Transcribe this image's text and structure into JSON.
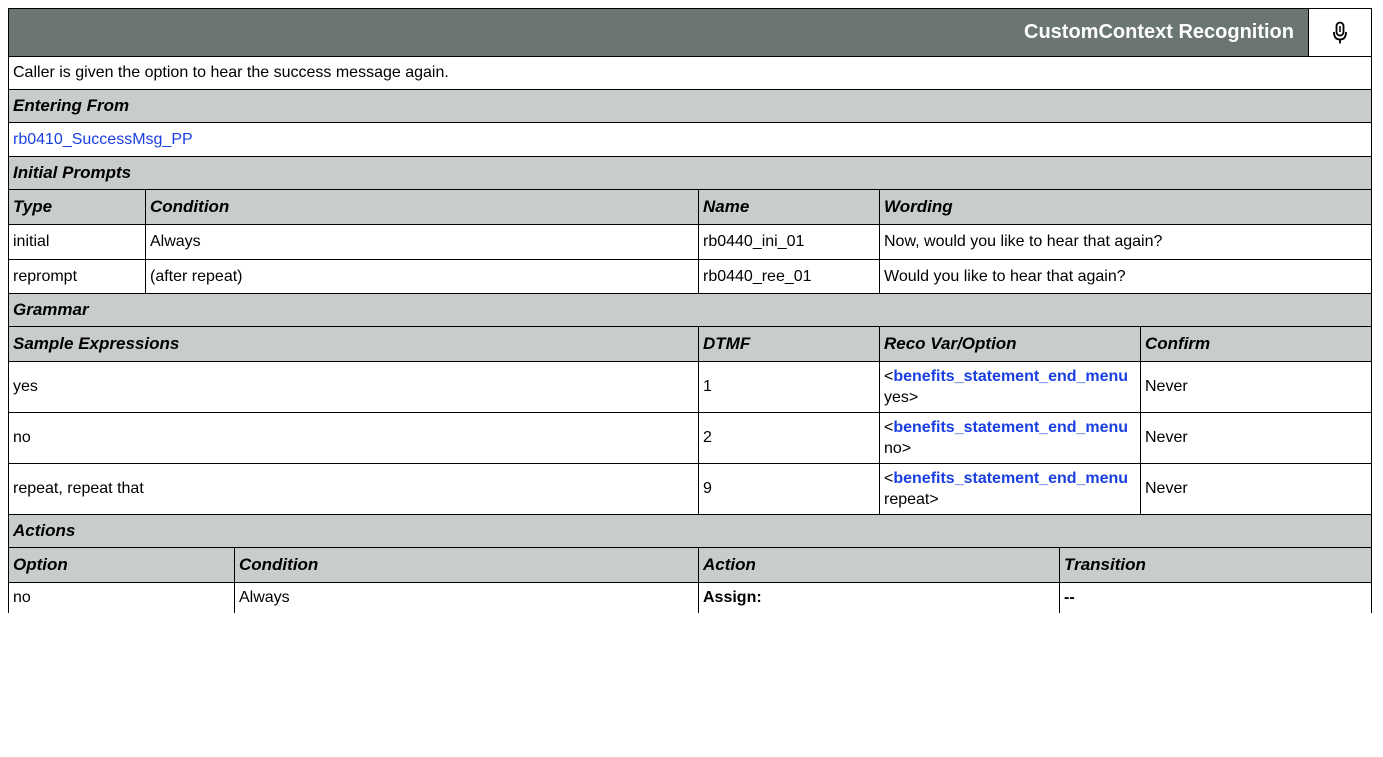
{
  "header": {
    "title": "CustomContext Recognition",
    "icon": "microphone-icon"
  },
  "description": "Caller is given the option to hear the success message again.",
  "entering_from": {
    "label": "Entering From",
    "link": "rb0410_SuccessMsg_PP"
  },
  "initial_prompts": {
    "label": "Initial Prompts",
    "columns": [
      "Type",
      "Condition",
      "Name",
      "Wording"
    ],
    "rows": [
      [
        "initial",
        "Always",
        "rb0440_ini_01",
        "Now, would you like to hear that again?"
      ],
      [
        "reprompt",
        "(after repeat)",
        "rb0440_ree_01",
        "Would you like to hear that again?"
      ]
    ]
  },
  "grammar": {
    "label": "Grammar",
    "columns": [
      "Sample Expressions",
      "DTMF",
      "Reco Var/Option",
      "Confirm"
    ],
    "rows": [
      {
        "expr": "yes",
        "dtmf": "1",
        "open": "<",
        "var": "benefits_statement_end_menu",
        "value": "yes>",
        "confirm": "Never"
      },
      {
        "expr": "no",
        "dtmf": "2",
        "open": "<",
        "var": "benefits_statement_end_menu",
        "value": "no>",
        "confirm": "Never"
      },
      {
        "expr": "repeat, repeat that",
        "dtmf": "9",
        "open": "<",
        "var": "benefits_statement_end_menu",
        "value": "repeat>",
        "confirm": "Never"
      }
    ]
  },
  "actions": {
    "label": "Actions",
    "columns": [
      "Option",
      "Condition",
      "Action",
      "Transition"
    ],
    "rows": [
      [
        "no",
        "Always",
        "Assign:",
        "--"
      ]
    ]
  },
  "colors": {
    "header_bg": "#6b7574",
    "section_bg": "#c8cccc",
    "link": "#1a3fe0"
  }
}
